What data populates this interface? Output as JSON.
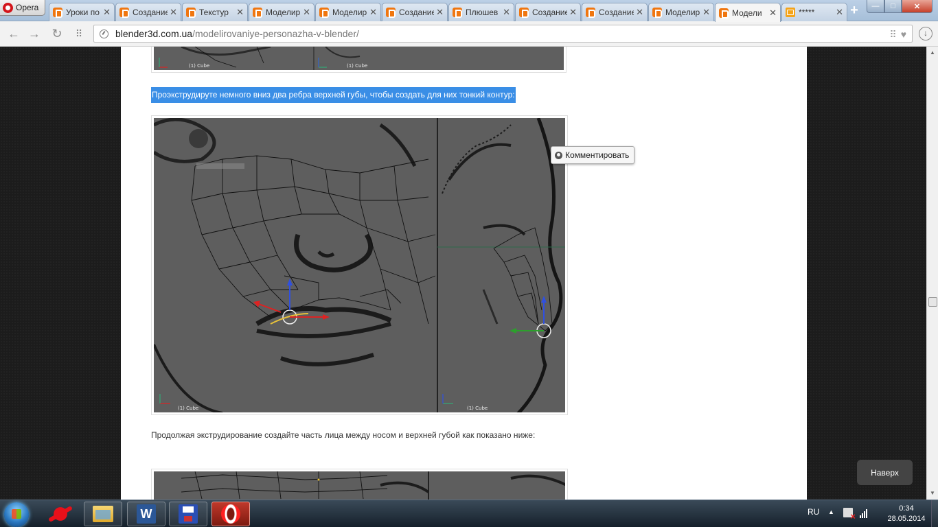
{
  "browser": {
    "menu_label": "Opera",
    "tabs": [
      {
        "title": "Уроки по",
        "icon": "blender-icon",
        "active": false
      },
      {
        "title": "Создание",
        "icon": "blender-icon",
        "active": false
      },
      {
        "title": "Текстур",
        "icon": "blender-icon",
        "active": false
      },
      {
        "title": "Моделир",
        "icon": "blender-icon",
        "active": false
      },
      {
        "title": "Моделир",
        "icon": "blender-icon",
        "active": false
      },
      {
        "title": "Создание",
        "icon": "blender-icon",
        "active": false
      },
      {
        "title": "Плюшев",
        "icon": "blender-icon",
        "active": false
      },
      {
        "title": "Создание",
        "icon": "blender-icon",
        "active": false
      },
      {
        "title": "Создание",
        "icon": "blender-icon",
        "active": false
      },
      {
        "title": "Моделир",
        "icon": "blender-icon",
        "active": false
      },
      {
        "title": "Модели",
        "icon": "blender-icon",
        "active": true
      },
      {
        "title": "*****",
        "icon": "mail-icon",
        "active": false
      }
    ],
    "new_tab_label": "+",
    "window_controls": {
      "minimize": "—",
      "maximize": "□",
      "close": "✕"
    },
    "address": {
      "host": "blender3d.com.ua",
      "path": "/modelirovaniye-personazha-v-blender/"
    }
  },
  "article": {
    "viewport_label": "(1) Cube",
    "highlighted_text": "Проэкструдируте немного вниз два ребра верхней губы, чтобы создать для них тонкий контур:",
    "paragraph": "Продолжая экструдирование создайте часть лица между носом и верхней губой как показано ниже:",
    "comment_popup": "Комментировать",
    "back_to_top": "Наверх"
  },
  "colors": {
    "selection": "#3a8ee6",
    "viewport_bg": "#606060",
    "accent_blender": "#f0760f"
  },
  "taskbar": {
    "apps": [
      {
        "name": "splat-app-icon",
        "running": false
      },
      {
        "name": "explorer-icon",
        "running": true
      },
      {
        "name": "word-icon",
        "running": true
      },
      {
        "name": "save-app-icon",
        "running": true
      },
      {
        "name": "opera-icon",
        "running": true,
        "active": true
      }
    ],
    "language": "RU",
    "time": "0:34",
    "date": "28.05.2014"
  }
}
